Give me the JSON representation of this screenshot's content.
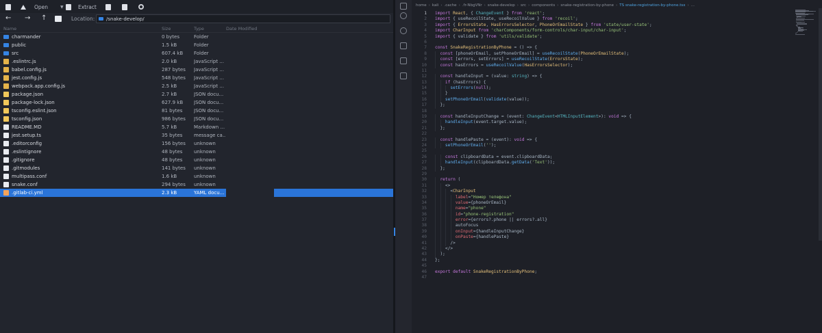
{
  "toolbar": {
    "open_label": "Open",
    "extract_label": "Extract"
  },
  "location": {
    "label": "Location:",
    "value": "/snake-develop/"
  },
  "columns": {
    "name": "Name",
    "size": "Size",
    "type": "Type",
    "modified": "Date Modified"
  },
  "files": [
    {
      "name": "charmander",
      "size": "0 bytes",
      "type": "Folder",
      "icon": "folder"
    },
    {
      "name": "public",
      "size": "1.5 kB",
      "type": "Folder",
      "icon": "folder"
    },
    {
      "name": "src",
      "size": "607.4 kB",
      "type": "Folder",
      "icon": "folder"
    },
    {
      "name": ".eslintrc.js",
      "size": "2.0 kB",
      "type": "JavaScript ...",
      "icon": "js"
    },
    {
      "name": "babel.config.js",
      "size": "287 bytes",
      "type": "JavaScript ...",
      "icon": "js"
    },
    {
      "name": "jest.config.js",
      "size": "548 bytes",
      "type": "JavaScript ...",
      "icon": "js"
    },
    {
      "name": "webpack.app.config.js",
      "size": "2.5 kB",
      "type": "JavaScript ...",
      "icon": "js"
    },
    {
      "name": "package.json",
      "size": "2.7 kB",
      "type": "JSON docu...",
      "icon": "json"
    },
    {
      "name": "package-lock.json",
      "size": "627.9 kB",
      "type": "JSON docu...",
      "icon": "json"
    },
    {
      "name": "tsconfig.eslint.json",
      "size": "81 bytes",
      "type": "JSON docu...",
      "icon": "json"
    },
    {
      "name": "tsconfig.json",
      "size": "986 bytes",
      "type": "JSON docu...",
      "icon": "json"
    },
    {
      "name": "README.MD",
      "size": "5.7 kB",
      "type": "Markdown ...",
      "icon": "text"
    },
    {
      "name": "jest.setup.ts",
      "size": "35 bytes",
      "type": "message ca...",
      "icon": "ts"
    },
    {
      "name": ".editorconfig",
      "size": "156 bytes",
      "type": "unknown",
      "icon": "text"
    },
    {
      "name": ".eslintignore",
      "size": "48 bytes",
      "type": "unknown",
      "icon": "text"
    },
    {
      "name": ".gitignore",
      "size": "48 bytes",
      "type": "unknown",
      "icon": "text"
    },
    {
      "name": ".gitmodules",
      "size": "141 bytes",
      "type": "unknown",
      "icon": "text"
    },
    {
      "name": "multipass.conf",
      "size": "1.6 kB",
      "type": "unknown",
      "icon": "text"
    },
    {
      "name": "snake.conf",
      "size": "294 bytes",
      "type": "unknown",
      "icon": "text"
    },
    {
      "name": ".gitlab-ci.yml",
      "size": "2.3 kB",
      "type": "YAML docu...",
      "icon": "yaml",
      "selected": true
    }
  ],
  "breadcrumb": [
    "home",
    "kali",
    ".cache",
    ".fr-NbgVNr",
    "snake-develop",
    "src",
    "components",
    "snake-registration-by-phone",
    "TS snake-registration-by-phone.tsx",
    "..."
  ],
  "code_lines": [
    "import React, { ChangeEvent } from 'react';",
    "import { useRecoilState, useRecoilValue } from 'recoil';",
    "import { ErrorsState, HasErrorsSelector, PhoneOrEmailState } from 'state/user-state';",
    "import CharInput from 'charComponents/form-controls/char-input/char-input';",
    "import { validate } from 'utils/validate';",
    "",
    "const SnakeRegistrationByPhone = () => {",
    "  const [phoneOrEmail, setPhoneOrEmail] = useRecoilState(PhoneOrEmailState);",
    "  const [errors, setErrors] = useRecoilState(ErrorsState);",
    "  const hasErrors = useRecoilValue(HasErrorsSelector);",
    "",
    "  const handleInput = (value: string) => {",
    "    if (hasErrors) {",
    "      setErrors(null);",
    "    }",
    "    setPhoneOrEmail(validate(value));",
    "  };",
    "",
    "  const handleInputChange = (event: ChangeEvent<HTMLInputElement>): void => {",
    "    handleInput(event.target.value);",
    "  };",
    "",
    "  const handlePaste = (event): void => {",
    "    setPhoneOrEmail('');",
    "",
    "    const clipboardData = event.clipboardData;",
    "    handleInput(clipboardData.getData('Text'));",
    "  };",
    "",
    "  return (",
    "    <>",
    "      <CharInput",
    "        label=\"Номер телефона\"",
    "        value={phoneOrEmail}",
    "        name=\"phone\"",
    "        id=\"phone-registration\"",
    "        error={errors?.phone || errors?.all}",
    "        autoFocus",
    "        onInput={handleInputChange}",
    "        onPaste={handlePaste}",
    "      />",
    "    </>",
    "  );",
    "};",
    "",
    "export default SnakeRegistrationByPhone;",
    ""
  ],
  "colors": {
    "selection": "#2a74d8",
    "folder": "#3584e4",
    "keyword": "#c678dd",
    "string": "#98c379",
    "function": "#61afef"
  }
}
